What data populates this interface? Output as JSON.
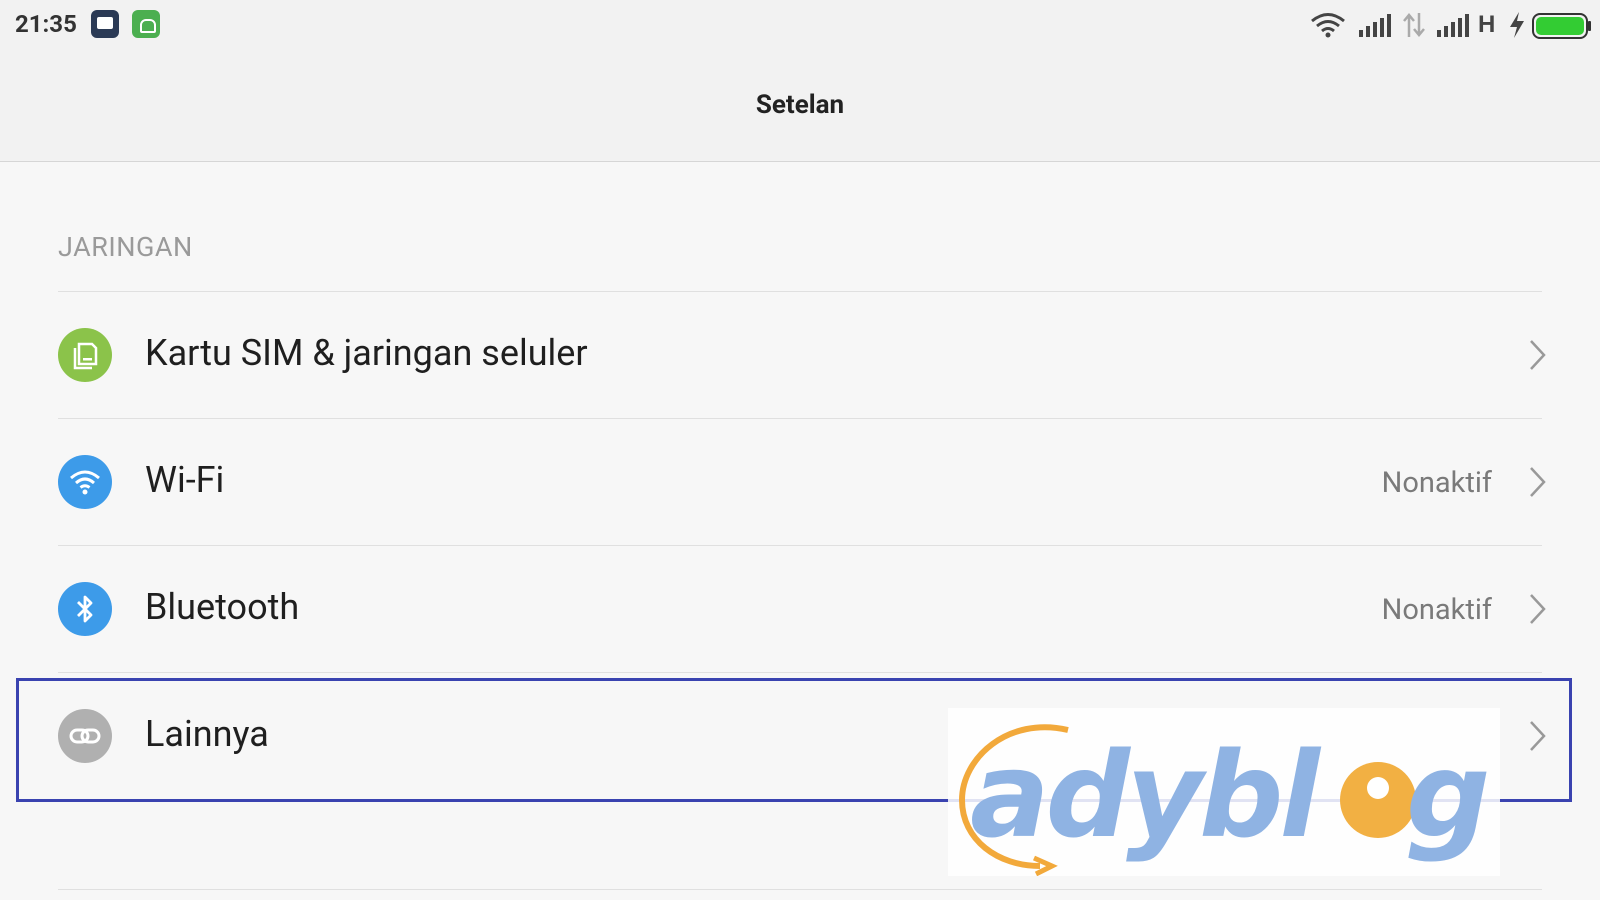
{
  "status_bar": {
    "time": "21:35",
    "network_type": "H",
    "battery_color": "#33cc33"
  },
  "header": {
    "title": "Setelan"
  },
  "section": {
    "title": "JARINGAN"
  },
  "items": [
    {
      "label": "Kartu SIM & jaringan seluler",
      "value": "",
      "icon": "sim-card-icon",
      "color": "#8bc34a"
    },
    {
      "label": "Wi-Fi",
      "value": "Nonaktif",
      "icon": "wifi-icon",
      "color": "#3d9be9"
    },
    {
      "label": "Bluetooth",
      "value": "Nonaktif",
      "icon": "bluetooth-icon",
      "color": "#3d9be9"
    },
    {
      "label": "Lainnya",
      "value": "",
      "icon": "link-icon",
      "color": "#b0b0b0"
    }
  ],
  "watermark": {
    "text": "adyblog"
  }
}
